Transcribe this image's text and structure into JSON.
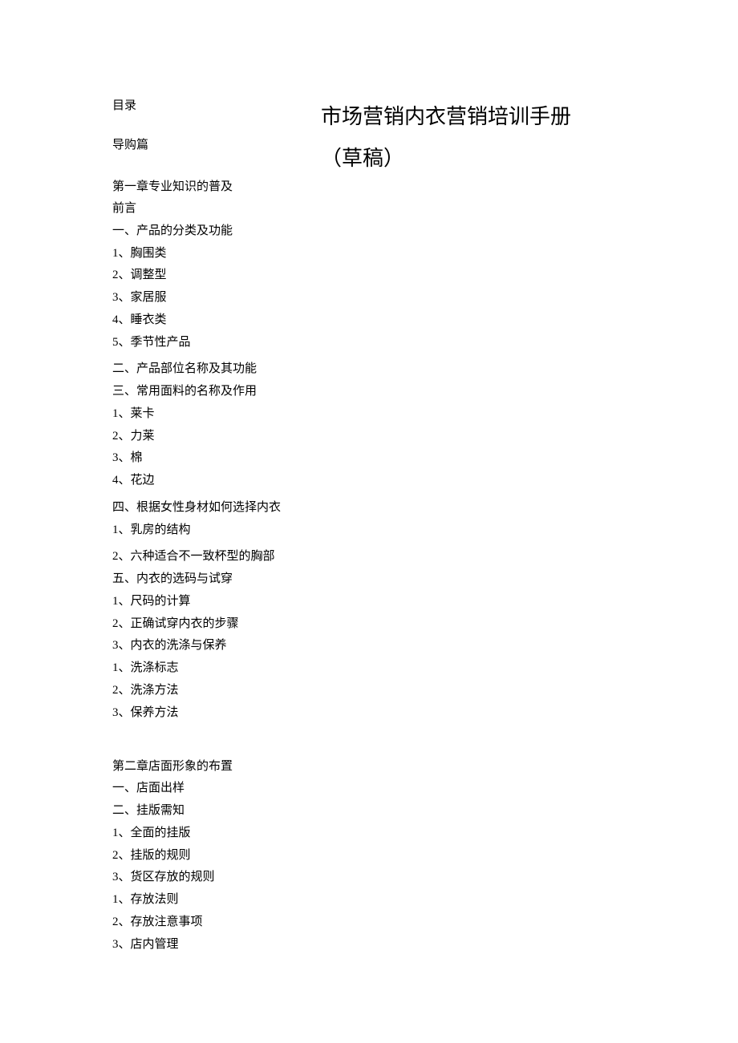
{
  "header": {
    "toc_label": "目录",
    "section_label": "导购篇",
    "title_main": "市场营销内衣营销培训手册",
    "title_sub": "（草稿）"
  },
  "chapter1": {
    "title": "第一章专业知识的普及",
    "preface": "前言",
    "s1": "一、产品的分类及功能",
    "s1_1": "1、胸围类",
    "s1_2": "2、调整型",
    "s1_3": "3、家居服",
    "s1_4": "4、睡衣类",
    "s1_5": "5、季节性产品",
    "s2": "二、产品部位名称及其功能",
    "s3": "三、常用面料的名称及作用",
    "s3_1": "1、莱卡",
    "s3_2": "2、力莱",
    "s3_3": "3、棉",
    "s3_4": "4、花边",
    "s4": "四、根据女性身材如何选择内衣",
    "s4_1": "1、乳房的结构",
    "s4_2": "2、六种适合不一致杯型的胸部",
    "s5": "五、内衣的选码与试穿",
    "s5_1": "1、尺码的计算",
    "s5_2": "2、正确试穿内衣的步骤",
    "s5_3": "3、内衣的洗涤与保养",
    "s5_3_1": "1、洗涤标志",
    "s5_3_2": "2、洗涤方法",
    "s5_3_3": "3、保养方法"
  },
  "chapter2": {
    "title": "第二章店面形象的布置",
    "s1": "一、店面出样",
    "s2": "二、挂版需知",
    "s2_1": "1、全面的挂版",
    "s2_2": "2、挂版的规则",
    "s2_3": "3、货区存放的规则",
    "s2_3_1": "1、存放法则",
    "s2_3_2": "2、存放注意事项",
    "s2_3_3": "3、店内管理"
  }
}
